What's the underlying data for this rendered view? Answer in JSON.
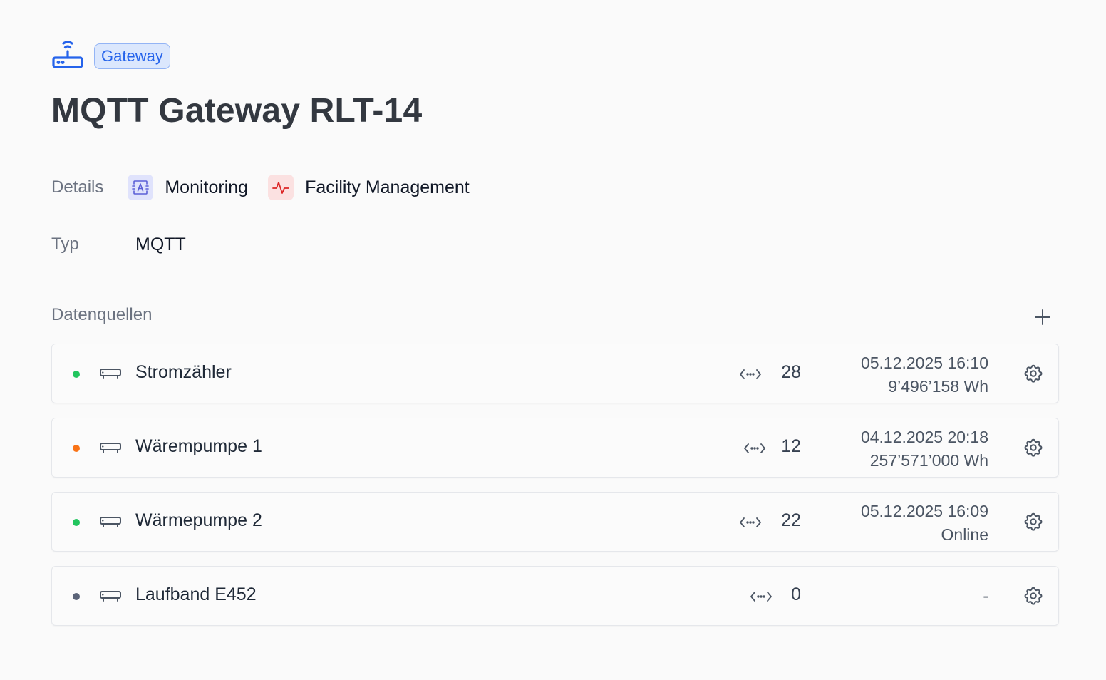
{
  "header": {
    "badge": "Gateway",
    "icon": "router-icon",
    "title": "MQTT Gateway RLT-14"
  },
  "details": {
    "label": "Details",
    "tags": [
      {
        "label": "Monitoring",
        "icon": "monitoring-icon",
        "color": "#5b5fd6"
      },
      {
        "label": "Facility Management",
        "icon": "activity-icon",
        "color": "#dc2626"
      }
    ]
  },
  "typ": {
    "label": "Typ",
    "value": "MQTT"
  },
  "datasources": {
    "title": "Datenquellen",
    "add_icon": "plus-icon",
    "items": [
      {
        "name": "Stromzähler",
        "status_color": "#22c55e",
        "count": "28",
        "date": "05.12.2025 16:10",
        "sub": "9’496’158 Wh"
      },
      {
        "name": "Wärempumpe 1",
        "status_color": "#f97316",
        "count": "12",
        "date": "04.12.2025 20:18",
        "sub": "257’571’000 Wh"
      },
      {
        "name": "Wärmepumpe 2",
        "status_color": "#22c55e",
        "count": "22",
        "date": "05.12.2025 16:09",
        "sub": "Online"
      },
      {
        "name": "Laufband E452",
        "status_color": "#5b6478",
        "count": "0",
        "date": "-",
        "sub": ""
      }
    ]
  }
}
